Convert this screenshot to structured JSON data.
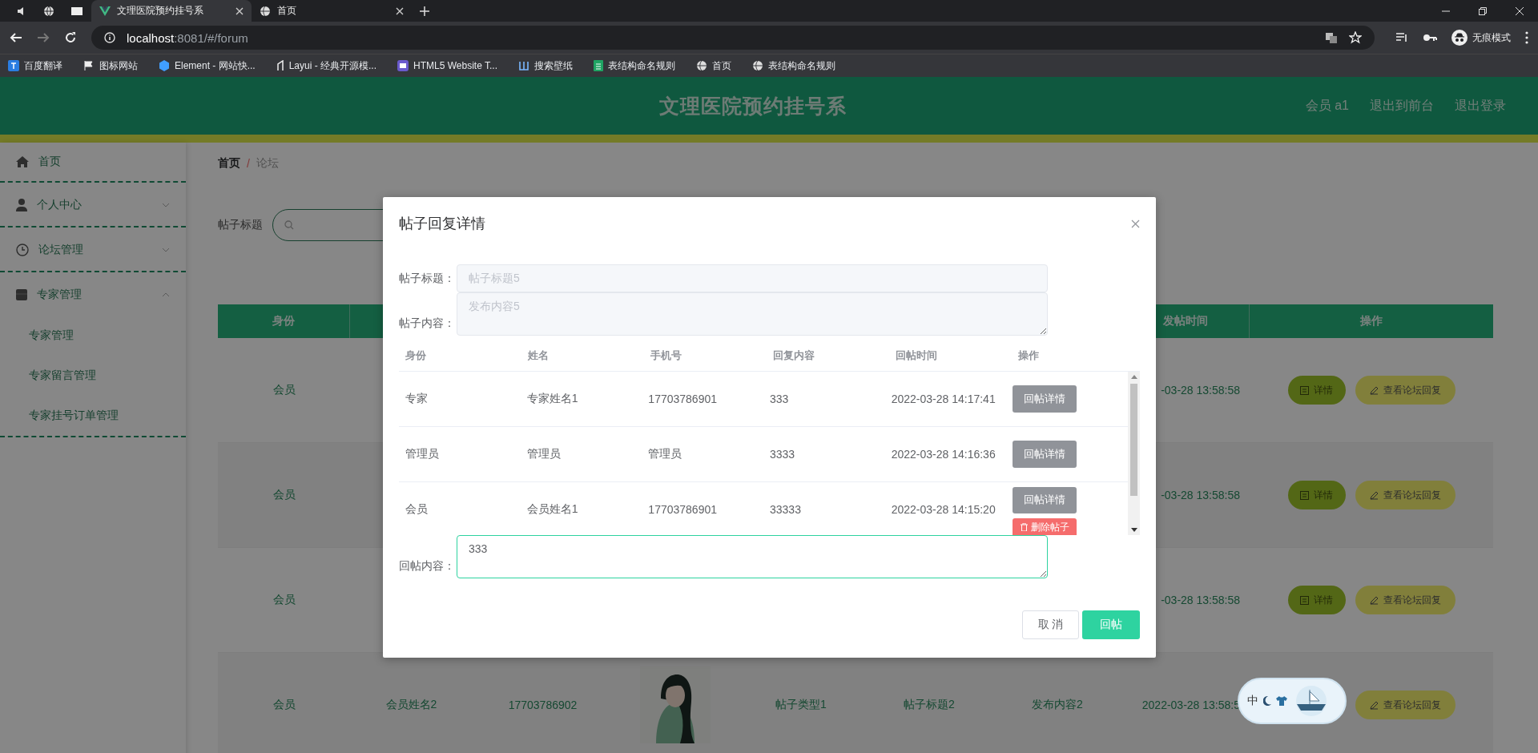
{
  "browser": {
    "tabs": [
      {
        "title": "文理医院预约挂号系",
        "selected": true
      },
      {
        "title": "首页",
        "selected": false
      }
    ],
    "url_host": "localhost",
    "url_rest": ":8081/#/forum",
    "profile_label": "无痕模式",
    "bookmarks": [
      {
        "label": "百度翻译"
      },
      {
        "label": "图标网站"
      },
      {
        "label": "Element - 网站快..."
      },
      {
        "label": "Layui - 经典开源模..."
      },
      {
        "label": "HTML5 Website T..."
      },
      {
        "label": "搜索壁纸"
      },
      {
        "label": "表结构命名规则"
      },
      {
        "label": "首页"
      },
      {
        "label": "表结构命名规则"
      }
    ]
  },
  "header": {
    "title": "文理医院预约挂号系",
    "links": [
      "会员 a1",
      "退出到前台",
      "退出登录"
    ]
  },
  "sidebar": {
    "items": [
      {
        "label": "首页"
      },
      {
        "label": "个人中心",
        "expanded": false
      },
      {
        "label": "论坛管理",
        "expanded": false
      },
      {
        "label": "专家管理",
        "expanded": true,
        "children": [
          {
            "label": "专家管理"
          },
          {
            "label": "专家留言管理"
          },
          {
            "label": "专家挂号订单管理"
          }
        ]
      }
    ]
  },
  "breadcrumb": {
    "items": [
      "首页",
      "论坛"
    ],
    "separator": "/"
  },
  "search": {
    "label": "帖子标题"
  },
  "table": {
    "columns": [
      {
        "label": "身份"
      },
      {
        "label": "发帖时间"
      },
      {
        "label": "操作"
      }
    ],
    "rows": [
      {
        "identity": "会员",
        "time": "-03-28 13:58:58",
        "actions": [
          {
            "kind": "detail",
            "label": "详情"
          },
          {
            "kind": "replies",
            "label": "查看论坛回复"
          }
        ]
      },
      {
        "identity": "会员",
        "time": "-03-28 13:58:58",
        "actions": [
          {
            "kind": "detail",
            "label": "详情"
          },
          {
            "kind": "replies",
            "label": "查看论坛回复"
          }
        ]
      },
      {
        "identity": "会员",
        "time": "-03-28 13:58:58",
        "actions": [
          {
            "kind": "detail",
            "label": "详情"
          },
          {
            "kind": "replies",
            "label": "查看论坛回复"
          }
        ]
      },
      {
        "identity": "会员",
        "name": "会员姓名2",
        "phone": "17703786902",
        "picture": {
          "kind": "picture"
        },
        "type": "帖子类型1",
        "title": "帖子标题2",
        "content": "发布内容2",
        "time": "2022-03-28 13:58:5",
        "actions": [
          {
            "kind": "replies",
            "label": "查看论坛回复"
          }
        ]
      }
    ]
  },
  "dialog": {
    "title": "帖子回复详情",
    "fields": [
      {
        "kind": "input",
        "label": "帖子标题：",
        "value": "帖子标题5",
        "disabled": true
      },
      {
        "kind": "textarea",
        "label": "帖子内容：",
        "value": "发布内容5",
        "disabled": true
      }
    ],
    "replies": {
      "columns": [
        "身份",
        "姓名",
        "手机号",
        "回复内容",
        "回帖时间",
        "操作"
      ],
      "rows": [
        {
          "identity": "专家",
          "name": "专家姓名1",
          "phone": "17703786901",
          "content": "333",
          "time": "2022-03-28 14:17:41",
          "actions": [
            {
              "kind": "detail",
              "label": "回帖详情"
            }
          ]
        },
        {
          "identity": "管理员",
          "name": "管理员",
          "phone": "管理员",
          "content": "3333",
          "time": "2022-03-28 14:16:36",
          "actions": [
            {
              "kind": "detail",
              "label": "回帖详情"
            }
          ]
        },
        {
          "identity": "会员",
          "name": "会员姓名1",
          "phone": "17703786901",
          "content": "33333",
          "time": "2022-03-28 14:15:20",
          "actions": [
            {
              "kind": "detail",
              "label": "回帖详情"
            },
            {
              "kind": "delete",
              "label": "删除帖子"
            }
          ]
        }
      ]
    },
    "reply": {
      "label": "回帖内容：",
      "value": "333"
    },
    "buttons": [
      {
        "kind": "cancel",
        "label": "取 消"
      },
      {
        "kind": "primary",
        "label": "回帖"
      }
    ]
  },
  "ime": {
    "label": "中"
  }
}
